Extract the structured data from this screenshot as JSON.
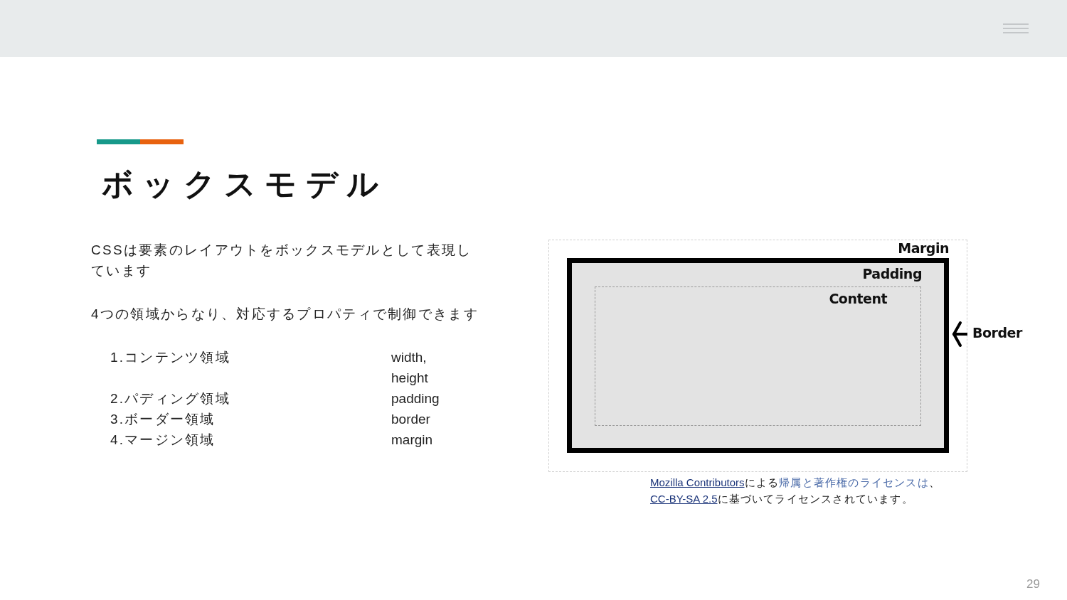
{
  "title": "ボックスモデル",
  "paragraphs": [
    "CSSは要素のレイアウトをボックスモデルとして表現しています",
    "4つの領域からなり、対応するプロパティで制御できます"
  ],
  "list": [
    {
      "number": "1.",
      "term": "コンテンツ領域",
      "property": "width, height"
    },
    {
      "number": "2.",
      "term": "パディング領域",
      "property": "padding"
    },
    {
      "number": "3.",
      "term": "ボーダー領域",
      "property": "border"
    },
    {
      "number": "4.",
      "term": "マージン領域",
      "property": "margin"
    }
  ],
  "diagram": {
    "labels": [
      {
        "kind": "margin",
        "text": "Margin"
      },
      {
        "kind": "padding",
        "text": "Padding"
      },
      {
        "kind": "content",
        "text": "Content"
      },
      {
        "kind": "border",
        "text": "Border"
      }
    ]
  },
  "caption": [
    {
      "kind": "link",
      "text": "Mozilla Contributors"
    },
    {
      "kind": "text",
      "text": "による"
    },
    {
      "kind": "soft-link",
      "text": "帰属と著作権のライセンスは"
    },
    {
      "kind": "text",
      "text": "、"
    },
    {
      "kind": "link",
      "text": "CC-BY-SA 2.5"
    },
    {
      "kind": "text",
      "text": "に基づいてライセンスされています。"
    }
  ],
  "page_number": "29"
}
